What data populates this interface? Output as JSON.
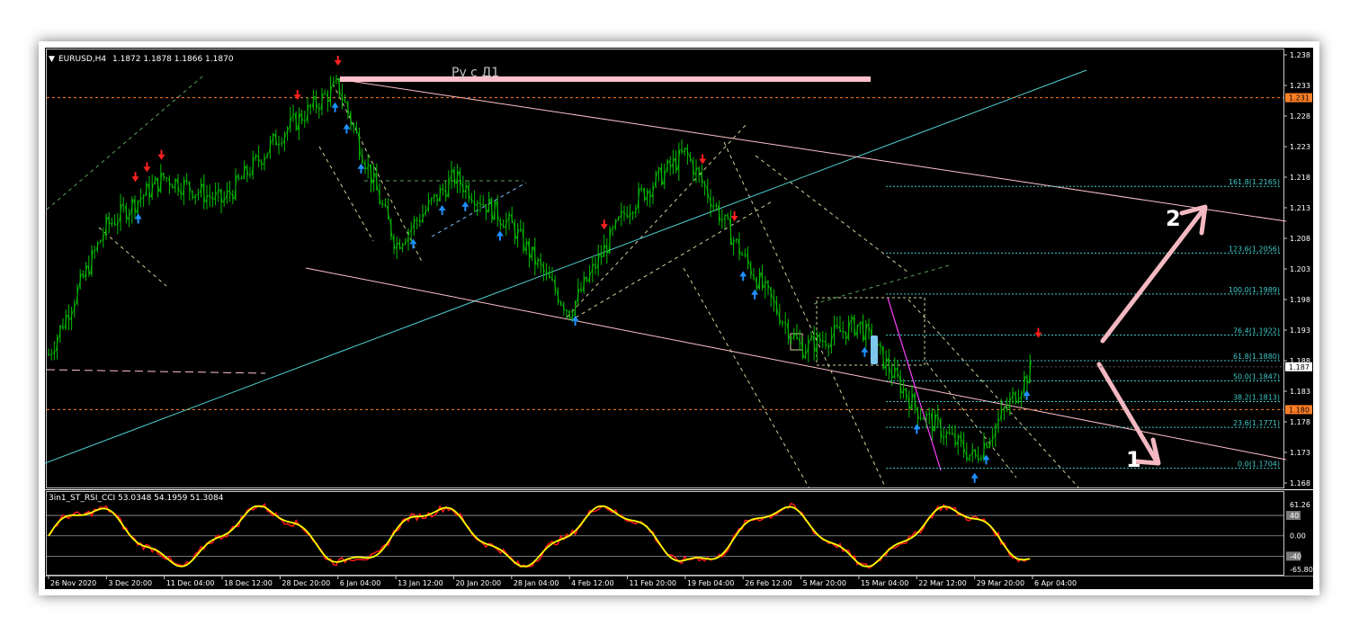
{
  "header": {
    "symbol": "EURUSD,H4",
    "ohlc": "1.1872 1.1878 1.1866 1.1870"
  },
  "annotations": {
    "resistance_label": "Ру с Д1",
    "scenario_1": "1",
    "scenario_2": "2"
  },
  "indicator": {
    "label": "3in1_ST_RSI_CCI 53.0348 54.1959 51.3084",
    "ticks": [
      "61.26",
      "40",
      "0.00",
      "-40",
      "-65.80"
    ],
    "colors": {
      "main": "#ffff00",
      "signal": "#ff1a1a"
    }
  },
  "colors": {
    "background": "#000000",
    "candles": "#00c000",
    "sell_arrow": "#ff2020",
    "buy_arrow": "#1e90ff",
    "fibo": "#40c8c8",
    "channel": "#ffc0cb",
    "trendline": "#4fd0d0",
    "price_level": "#ff7f27"
  },
  "chart_data": {
    "type": "line",
    "title": "EURUSD,H4",
    "x": [
      "26 Nov 2020",
      "3 Dec 20:00",
      "11 Dec 04:00",
      "18 Dec 12:00",
      "28 Dec 20:00",
      "6 Jan 04:00",
      "13 Jan 12:00",
      "20 Jan 20:00",
      "28 Jan 04:00",
      "4 Feb 12:00",
      "11 Feb 20:00",
      "19 Feb 04:00",
      "26 Feb 12:00",
      "5 Mar 20:00",
      "15 Mar 04:00",
      "22 Mar 12:00",
      "29 Mar 20:00",
      "6 Apr 04:00"
    ],
    "series": [
      {
        "values": [
          1.189,
          1.21,
          1.218,
          1.214,
          1.225,
          1.233,
          1.207,
          1.218,
          1.21,
          1.196,
          1.213,
          1.222,
          1.205,
          1.19,
          1.194,
          1.18,
          1.172,
          1.187
        ]
      }
    ],
    "ylim": [
      1.168,
      1.238
    ],
    "y_ticks": [
      "1.238",
      "1.233",
      "1.228",
      "1.223",
      "1.218",
      "1.213",
      "1.208",
      "1.203",
      "1.198",
      "1.193",
      "1.188",
      "1.183",
      "1.178",
      "1.173",
      "1.168"
    ],
    "current_price": "1.1870",
    "current_price_label": "1.187",
    "price_levels": [
      {
        "value": 1.231,
        "label": "1.231"
      },
      {
        "value": 1.18,
        "label": "1.180"
      }
    ],
    "fibonacci": [
      {
        "label": "161.8(1.2165)",
        "value": 1.2165
      },
      {
        "label": "123.6(1.2056)",
        "value": 1.2056
      },
      {
        "label": "100.0(1.1989)",
        "value": 1.1989
      },
      {
        "label": "76.4(1.1922)",
        "value": 1.1922
      },
      {
        "label": "61.8(1.1880)",
        "value": 1.188
      },
      {
        "label": "50.0(1.1847)",
        "value": 1.1847
      },
      {
        "label": "38.2(1.1813)",
        "value": 1.1813
      },
      {
        "label": "23.6(1.1771)",
        "value": 1.1771
      },
      {
        "label": "0.0(1.1704)",
        "value": 1.1704
      }
    ],
    "grid": false
  }
}
